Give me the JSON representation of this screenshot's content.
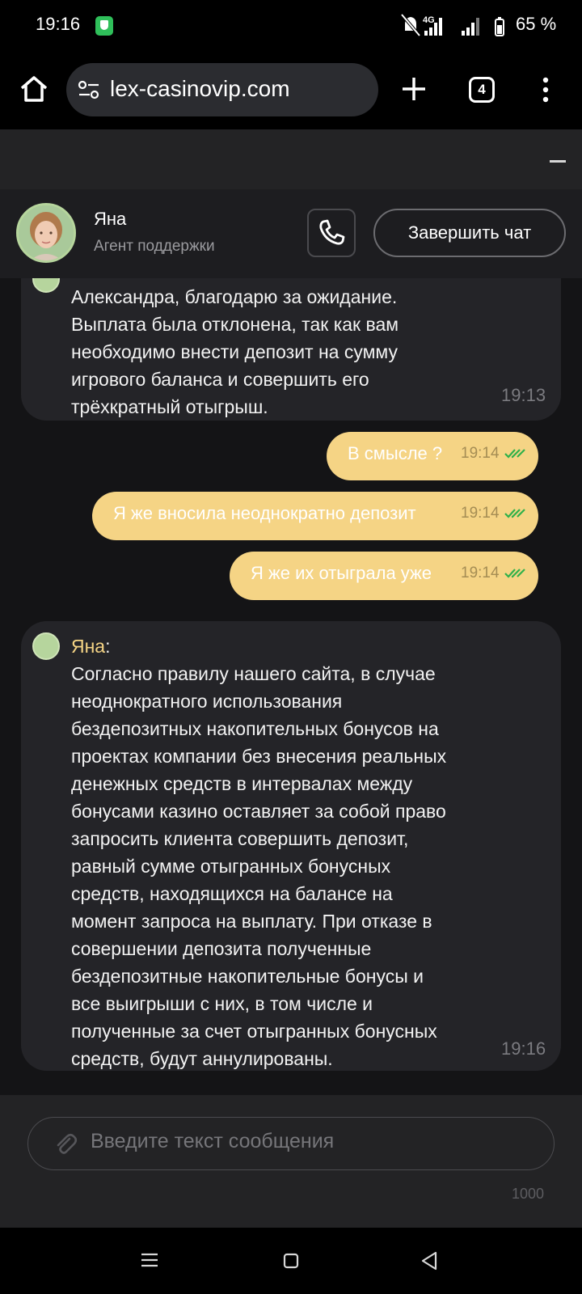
{
  "status_bar": {
    "time": "19:16",
    "network": "4G",
    "battery": "65 %"
  },
  "browser": {
    "url": "lex-casinovip.com",
    "tab_count": "4"
  },
  "chat_header": {
    "agent_name": "Яна",
    "agent_role": "Агент поддержки",
    "end_chat_label": "Завершить чат"
  },
  "messages": [
    {
      "direction": "in",
      "text": "Александра, благодарю за ожидание.\nВыплата была отклонена, так как вам\nнеобходимо внести депозит на сумму\nигрового баланса и совершить его\nтрёхкратный отыгрыш.",
      "time": "19:13"
    },
    {
      "direction": "out",
      "text": "В смысле ?",
      "time": "19:14"
    },
    {
      "direction": "out",
      "text": "Я же вносила неоднократно депозит",
      "time": "19:14"
    },
    {
      "direction": "out",
      "text": "Я же их отыграла уже",
      "time": "19:14"
    },
    {
      "direction": "in",
      "sender": "Яна",
      "sender_suffix": ":",
      "text": "Согласно правилу нашего сайта, в случае\nнеоднократного использования\nбездепозитных накопительных бонусов на\nпроектах компании без внесения реальных\nденежных средств в интервалах между\nбонусами казино оставляет за собой право\nзапросить клиента совершить депозит,\nравный сумме отыгранных бонусных\nсредств, находящихся на балансе на\nмомент запроса на выплату. При отказе в\nсовершении депозита полученные\nбездепозитные накопительные бонусы и\nвсе выигрыши с них, в том числе и\nполученные за счет отыгранных бонусных\nсредств, будут аннулированы.",
      "time": "19:16"
    }
  ],
  "input": {
    "placeholder": "Введите текст сообщения",
    "char_limit": "1000"
  },
  "colors": {
    "outgoing_bubble": "#f5d485",
    "incoming_bubble": "#242428",
    "read_check": "#2fb14a",
    "sender_name": "#f5d485"
  }
}
